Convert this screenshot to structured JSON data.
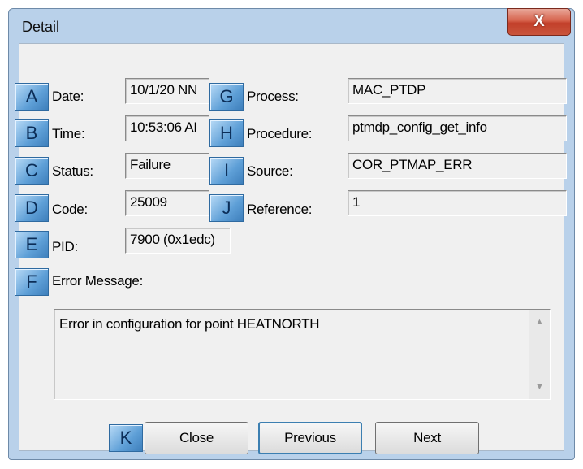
{
  "window": {
    "title": "Detail",
    "close_glyph": "X"
  },
  "badges": {
    "a": "A",
    "b": "B",
    "c": "C",
    "d": "D",
    "e": "E",
    "f": "F",
    "g": "G",
    "h": "H",
    "i": "I",
    "j": "J",
    "k": "K"
  },
  "left_fields": {
    "date": {
      "label": "Date:",
      "value": "10/1/20 NN"
    },
    "time": {
      "label": "Time:",
      "value": "10:53:06 AI"
    },
    "status": {
      "label": "Status:",
      "value": "Failure"
    },
    "code": {
      "label": "Code:",
      "value": "25009"
    },
    "pid": {
      "label": "PID:",
      "value": "7900 (0x1edc)"
    }
  },
  "right_fields": {
    "process": {
      "label": "Process:",
      "value": "MAC_PTDP"
    },
    "procedure": {
      "label": "Procedure:",
      "value": "ptmdp_config_get_info"
    },
    "source": {
      "label": "Source:",
      "value": "COR_PTMAP_ERR"
    },
    "reference": {
      "label": "Reference:",
      "value": "1"
    }
  },
  "error": {
    "label": "Error Message:",
    "value": "Error in configuration for point HEATNORTH"
  },
  "buttons": {
    "close": "Close",
    "previous": "Previous",
    "next": "Next"
  },
  "colors": {
    "badge": "#5e9fd7",
    "close_button": "#c9553c",
    "frame": "#b9d1ea"
  }
}
